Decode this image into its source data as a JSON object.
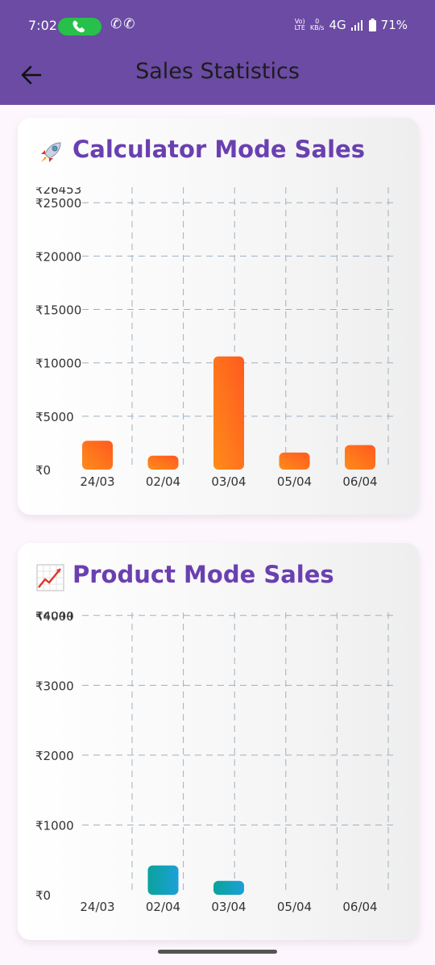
{
  "status_bar": {
    "time": "7:02",
    "network": "4G",
    "battery": "71%",
    "volte": "Vo)\nLTE",
    "kbs": "0\nKB/s"
  },
  "app_bar": {
    "title": "Sales Statistics",
    "back_icon": "arrow-left-icon"
  },
  "colors": {
    "primary": "#6b4ba3",
    "title_purple": "#6a40b0",
    "calc_bar_top": "#ff5a1f",
    "calc_bar_bottom": "#ff8c1a",
    "product_bar_left": "#0aa39a",
    "product_bar_right": "#1ba0d8",
    "grid": "#9fb0c0"
  },
  "cards": [
    {
      "emoji": "rocket-icon",
      "title": "Calculator Mode Sales"
    },
    {
      "emoji": "chart-increasing-icon",
      "title": "Product Mode Sales"
    }
  ],
  "chart_data": [
    {
      "type": "bar",
      "title": "Calculator Mode Sales",
      "categories": [
        "24/03",
        "02/04",
        "03/04",
        "05/04",
        "06/04"
      ],
      "values": [
        2700,
        1300,
        10600,
        1600,
        2300
      ],
      "ylim": [
        0,
        26453
      ],
      "yticks": [
        0,
        5000,
        10000,
        15000,
        20000,
        25000
      ],
      "ytick_labels": [
        "₹0",
        "₹5000",
        "₹10000",
        "₹15000",
        "₹20000",
        "₹25000"
      ],
      "top_label": "₹26453",
      "grid": true
    },
    {
      "type": "bar",
      "title": "Product Mode Sales",
      "categories": [
        "24/03",
        "02/04",
        "03/04",
        "05/04",
        "06/04"
      ],
      "values": [
        0,
        420,
        200,
        0,
        0
      ],
      "ylim": [
        0,
        4044
      ],
      "yticks": [
        0,
        1000,
        2000,
        3000,
        4000
      ],
      "ytick_labels": [
        "₹0",
        "₹1000",
        "₹2000",
        "₹3000",
        "₹4000"
      ],
      "top_label": "₹4044",
      "grid": true
    }
  ]
}
